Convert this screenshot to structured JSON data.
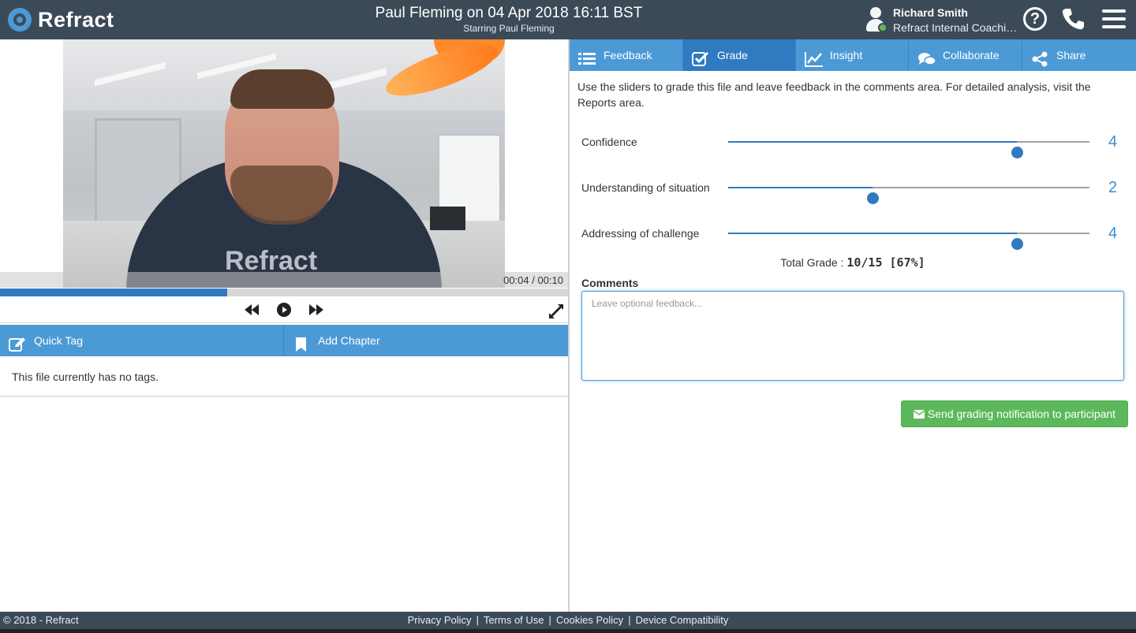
{
  "header": {
    "brand": "Refract",
    "title": "Paul Fleming on 04 Apr 2018 16:11 BST",
    "subtitle": "Starring Paul Fleming",
    "user_name": "Richard Smith",
    "user_org": "Refract Internal Coaching",
    "icons": [
      "help-icon",
      "phone-icon",
      "menu-icon"
    ]
  },
  "video": {
    "watermark": "Refract",
    "time_display": "00:04 / 00:10",
    "progress_fraction": 0.4
  },
  "tag_bar": {
    "quick_tag": "Quick Tag",
    "add_chapter": "Add Chapter"
  },
  "tags": {
    "empty_message": "This file currently has no tags."
  },
  "tabs": [
    {
      "label": "Feedback",
      "icon": "list-icon"
    },
    {
      "label": "Grade",
      "icon": "checkbox-icon",
      "active": true
    },
    {
      "label": "Insight",
      "icon": "chart-icon"
    },
    {
      "label": "Collaborate",
      "icon": "chat-icon"
    },
    {
      "label": "Share",
      "icon": "share-icon"
    }
  ],
  "grade": {
    "intro": "Use the sliders to grade this file and leave feedback in the comments area. For detailed analysis, visit the Reports area.",
    "slider_max": 5,
    "sliders": [
      {
        "label": "Confidence",
        "value": 4,
        "display": "4"
      },
      {
        "label": "Understanding of situation",
        "value": 2,
        "display": "2"
      },
      {
        "label": "Addressing of challenge",
        "value": 4,
        "display": "4"
      }
    ],
    "total_label": "Total Grade :",
    "total_value": "10/15 [67%]",
    "comments_label": "Comments",
    "comments_placeholder": "Leave optional feedback...",
    "send_button": "Send grading notification to participant"
  },
  "footer": {
    "copyright": "© 2018 - Refract",
    "links": [
      "Privacy Policy",
      "Terms of Use",
      "Cookies Policy",
      "Device Compatibility"
    ]
  },
  "colors": {
    "header_bg": "#3c4a58",
    "accent": "#4b9ad6",
    "accent_active": "#2f7ac0",
    "success": "#5cb85c"
  }
}
